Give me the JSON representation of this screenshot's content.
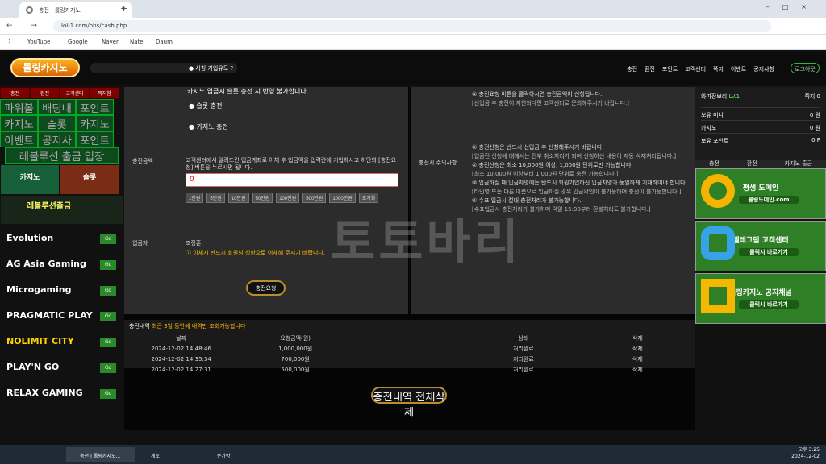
{
  "browser": {
    "tab_title": "충전 | 롤링카지노",
    "url": "lol-1.com/bbs/cash.php",
    "bookmarks": [
      "YouTube",
      "Google",
      "Naver",
      "Nate",
      "Daum"
    ]
  },
  "site": {
    "logo": "롤링카지노",
    "marquee": "● 사칭 가입유도 ?",
    "top_nav": [
      "충전",
      "환전",
      "포인트",
      "고객센터",
      "쪽지",
      "이벤트",
      "공지사항"
    ],
    "logout": "로그아웃"
  },
  "left": {
    "tabs": [
      "충전",
      "환전",
      "고객센터",
      "쪽지함"
    ],
    "menu": [
      "파워볼",
      "배팅내역",
      "포인트 전환",
      "카지노",
      "슬롯",
      "카지노 출금",
      "이벤트",
      "공지사항",
      "포인트 내역",
      "레볼루션 출금 입장"
    ],
    "banners": [
      "카지노",
      "슬롯",
      "레볼루션출금"
    ],
    "providers": [
      "Evolution",
      "AG Asia Gaming",
      "Microgaming",
      "PRAGMATIC PLAY",
      "NOLIMIT CITY",
      "PLAY'N GO",
      "RELAX GAMING"
    ],
    "go": "Go"
  },
  "main": {
    "top_text": "카지노 입금시 슬롯 충전 시 반영 불가합니다.",
    "option_slot": "슬롯 충전",
    "option_casino": "카지노 충전",
    "amount_label": "충전금액",
    "amount_help": "고객센터에서 알려드린 입금계좌로 이체 후 입금액을 입력란에 기입하시고 하단의 [충전요청] 버튼을 누르시면 됩니다.",
    "amount_value": "0",
    "chips": [
      "1만원",
      "5만원",
      "10만원",
      "50만원",
      "100만원",
      "500만원",
      "1000만원",
      "초기화"
    ],
    "payer_label": "입금자",
    "payer_name": "조정훈",
    "payer_warning": "ⓘ 이체시 반드시 회원님 성함으로 이체해 주시기 바랍니다.",
    "request": "충전요청",
    "notice_title": "충전시 주의사항",
    "notices": [
      "④ 충전요청 버튼을 클릭하시면 충전금액이 신청됩니다.",
      "[선입금 후 충전이 지연되다면 고객센터로 문의해주시기 바랍니다.]",
      "① 충전신청은 반드시 선입금 후 신청해주시기 바랍니다.",
      "[입금전 신청에 대해서는 전부 취소처리가 되며 신청하신 내용이 자동 삭제처리됩니다.]",
      "② 충전신청은 최소 10,000원 이상, 1,000원 단위로만 가능합니다.",
      "[최소 10,000원 이상부터 1,000원 단위로 충전 가능합니다.]",
      "③ 입금하실 때 입금자명에는 반드시 회원가입하신 입금자명과 동일하게 기재하여야 합니다.",
      "[타인명 또는 다른 이름으로 입금하실 경우 입금확인이 불가능하며 충전이 불가능합니다.]",
      "④ 수표 입금시 절대 충전처리가 불가능합니다.",
      "[수표입금시 충전처리가 불가하며 익일 15:00부터 환불처리도 불가합니다.]"
    ],
    "history_title": "충전내역",
    "history_sub": "최근 3일 동안에 내역만 조회가능합니다",
    "columns": [
      "날짜",
      "요청금액(원)",
      "",
      "상태",
      "삭제"
    ],
    "rows": [
      [
        "2024-12-02 14:48:46",
        "1,000,000원",
        "",
        "처리완료",
        "삭제"
      ],
      [
        "2024-12-02 14:35:34",
        "700,000원",
        "",
        "처리완료",
        "삭제"
      ],
      [
        "2024-12-02 14:27:31",
        "500,000원",
        "",
        "처리완료",
        "삭제"
      ]
    ],
    "delete_all": "충전내역 전체삭제",
    "watermark": "토토바리"
  },
  "right": {
    "user": "와따장보리",
    "level": "LV.1",
    "messages": "쪽지 0",
    "money": "보유 머니",
    "money_val": "0 원",
    "casino": "카지노",
    "casino_val": "0 원",
    "points": "보유 포인트",
    "points_val": "0 P",
    "actions": [
      "충전",
      "환전",
      "카지노 출금"
    ],
    "banners": [
      {
        "title": "평생 도메인",
        "sub": "롤링도메인.com"
      },
      {
        "title": "텔레그램 고객센터",
        "sub": "클릭시 바로가기"
      },
      {
        "title": "롤링카지노 공지채널",
        "sub": "클릭시 바로가기"
      }
    ]
  },
  "taskbar": {
    "apps": [
      "충전 | 롤링카지노...",
      "게토",
      "손가방"
    ],
    "time": "오후 3:25",
    "date": "2024-12-02"
  }
}
